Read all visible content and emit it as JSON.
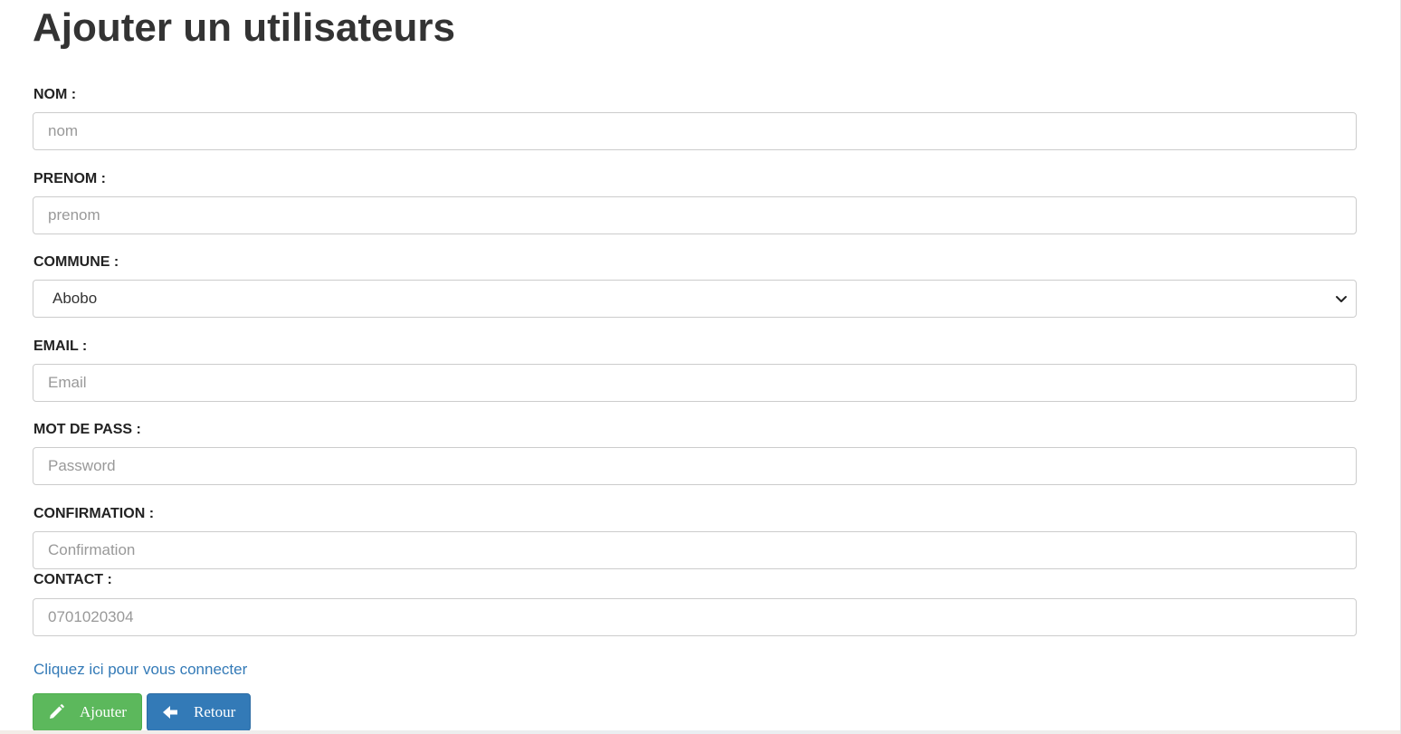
{
  "page": {
    "title": "Ajouter un utilisateurs"
  },
  "form": {
    "nom": {
      "label": "NOM :",
      "placeholder": "nom"
    },
    "prenom": {
      "label": "PRENOM :",
      "placeholder": "prenom"
    },
    "commune": {
      "label": "COMMUNE :",
      "value": "Abobo"
    },
    "email": {
      "label": "EMAIL :",
      "placeholder": "Email"
    },
    "password": {
      "label": "MOT DE PASS :",
      "placeholder": "Password"
    },
    "confirmation": {
      "label": "CONFIRMATION :",
      "placeholder": "Confirmation"
    },
    "contact": {
      "label": "CONTACT :",
      "placeholder": "0701020304"
    }
  },
  "links": {
    "login": "Cliquez ici pour vous connecter"
  },
  "buttons": {
    "add_label": "Ajouter",
    "add_icon": "pencil-icon",
    "back_label": "Retour",
    "back_icon": "arrow-left-icon"
  },
  "colors": {
    "add_button": "#5cb85c",
    "back_button": "#337ab7",
    "link": "#337ab7",
    "title": "#333333"
  }
}
